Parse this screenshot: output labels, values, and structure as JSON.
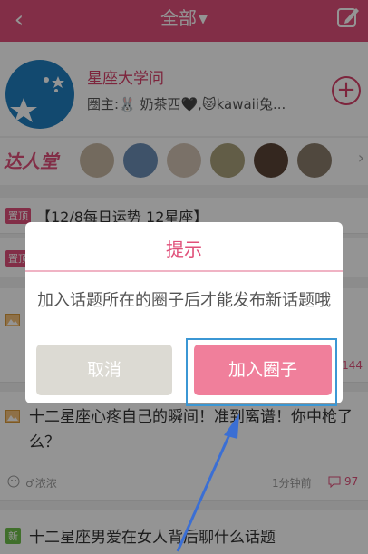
{
  "header": {
    "title": "全部",
    "caret": "▼",
    "back": "‹"
  },
  "circle": {
    "name": "星座大学问",
    "owner": "圈主:🐰 奶茶西🖤,😻kawaii兔...",
    "join_plus": "+"
  },
  "talent": {
    "label": "达人堂",
    "more": "›"
  },
  "pinned": [
    {
      "tag": "置顶",
      "title": "【12/8每日运势 12星座】"
    },
    {
      "tag": "置顶",
      "title": ""
    }
  ],
  "posts": [
    {
      "title": "十二星座心疼自己的瞬间！准到离谱！你中枪了么？",
      "author": "♂浓浓",
      "time": "1分钟前",
      "comments": "97"
    },
    {
      "tag": "新",
      "title": "十二星座男爱在女人背后聊什么话题"
    }
  ],
  "hidden_count": "144",
  "dialog": {
    "title": "提示",
    "message": "加入话题所在的圈子后才能发布新话题哦",
    "cancel": "取消",
    "join": "加入圈子"
  },
  "colors": {
    "brand": "#e0507a",
    "join_button": "#f07f9b",
    "cancel_button": "#dcdad3",
    "highlight": "#3b97d4"
  }
}
